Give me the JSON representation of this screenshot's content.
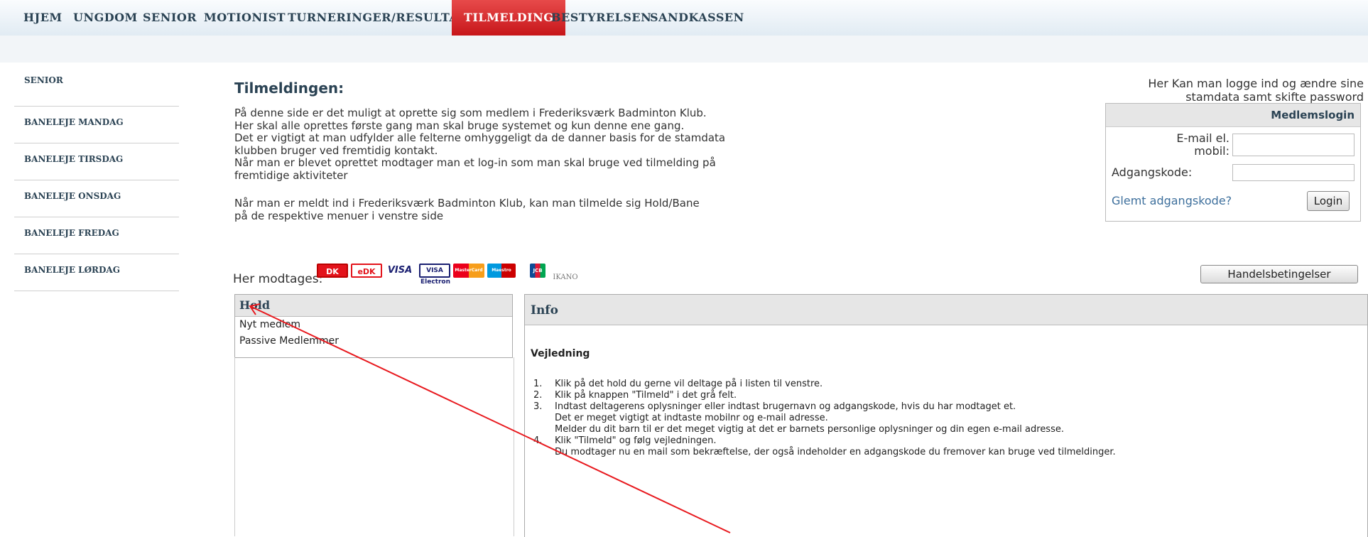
{
  "nav": {
    "items": [
      "HJEM",
      "UNGDOM",
      "SENIOR",
      "MOTIONIST",
      "TURNERINGER/RESULTATER",
      "TILMELDING",
      "BESTYRELSEN",
      "SANDKASSEN"
    ],
    "active": "TILMELDING"
  },
  "sidebar": {
    "items": [
      "SENIOR",
      "BANELEJE MANDAG",
      "BANELEJE TIRSDAG",
      "BANELEJE ONSDAG",
      "BANELEJE FREDAG",
      "BANELEJE LØRDAG"
    ]
  },
  "main": {
    "title": "Tilmeldingen:",
    "intro": [
      "På denne side er det muligt at oprette sig som medlem i Frederiksværk Badminton Klub.",
      "Her skal alle oprettes første gang man skal bruge systemet og kun denne ene gang.",
      "Det er vigtigt at man udfylder alle felterne omhyggeligt da de danner basis for de stamdata",
      "klubben bruger ved fremtidig kontakt.",
      "Når man er blevet oprettet modtager man et log-in som man skal bruge ved tilmelding på",
      "fremtidige aktiviteter"
    ],
    "intro2": [
      "Når man er meldt ind i Frederiksværk Badminton Klub, kan man tilmelde sig Hold/Bane",
      "på de respektive menuer i venstre side"
    ]
  },
  "login": {
    "note_line1": "Her Kan man logge ind og ændre sine",
    "note_line2": "stamdata samt skifte password",
    "title": "Medlemslogin",
    "email_label_1": "E-mail el.",
    "email_label_2": "mobil:",
    "email_value": "",
    "password_label": "Adgangskode:",
    "password_value": "",
    "forgot": "Glemt adgangskode?",
    "button": "Login"
  },
  "payment": {
    "label": "Her modtages:",
    "cards": [
      "DK",
      "eDK",
      "VISA",
      "VISA Electron",
      "MasterCard",
      "Maestro",
      "JCB",
      "IKANO"
    ],
    "terms_button": "Handelsbetingelser"
  },
  "hold": {
    "title": "Hold",
    "items": [
      "Nyt medlem",
      "Passive Medlemmer"
    ]
  },
  "info": {
    "title": "Info",
    "subtitle": "Vejledning",
    "steps": [
      {
        "num": "1.",
        "lines": [
          "Klik på det hold du gerne vil deltage på i listen til venstre."
        ]
      },
      {
        "num": "2.",
        "lines": [
          "Klik på knappen \"Tilmeld\" i det grå felt."
        ]
      },
      {
        "num": "3.",
        "lines": [
          "Indtast deltagerens oplysninger eller indtast brugernavn og adgangskode, hvis du har modtaget et.",
          "Det er meget vigtigt at indtaste mobilnr og e-mail adresse.",
          "Melder du dit barn til er det meget vigtig at det er barnets personlige oplysninger og din egen e-mail adresse."
        ]
      },
      {
        "num": "4.",
        "lines": [
          "Klik \"Tilmeld\" og følg vejledningen.",
          "Du modtager nu en mail som bekræftelse, der også indeholder en adgangskode du fremover kan bruge ved tilmeldinger."
        ]
      }
    ]
  },
  "colors": {
    "nav_text": "#2b4354",
    "active_tab": "#d42a2a",
    "link": "#3d6f9c",
    "annotation_arrow": "#e8191e"
  }
}
